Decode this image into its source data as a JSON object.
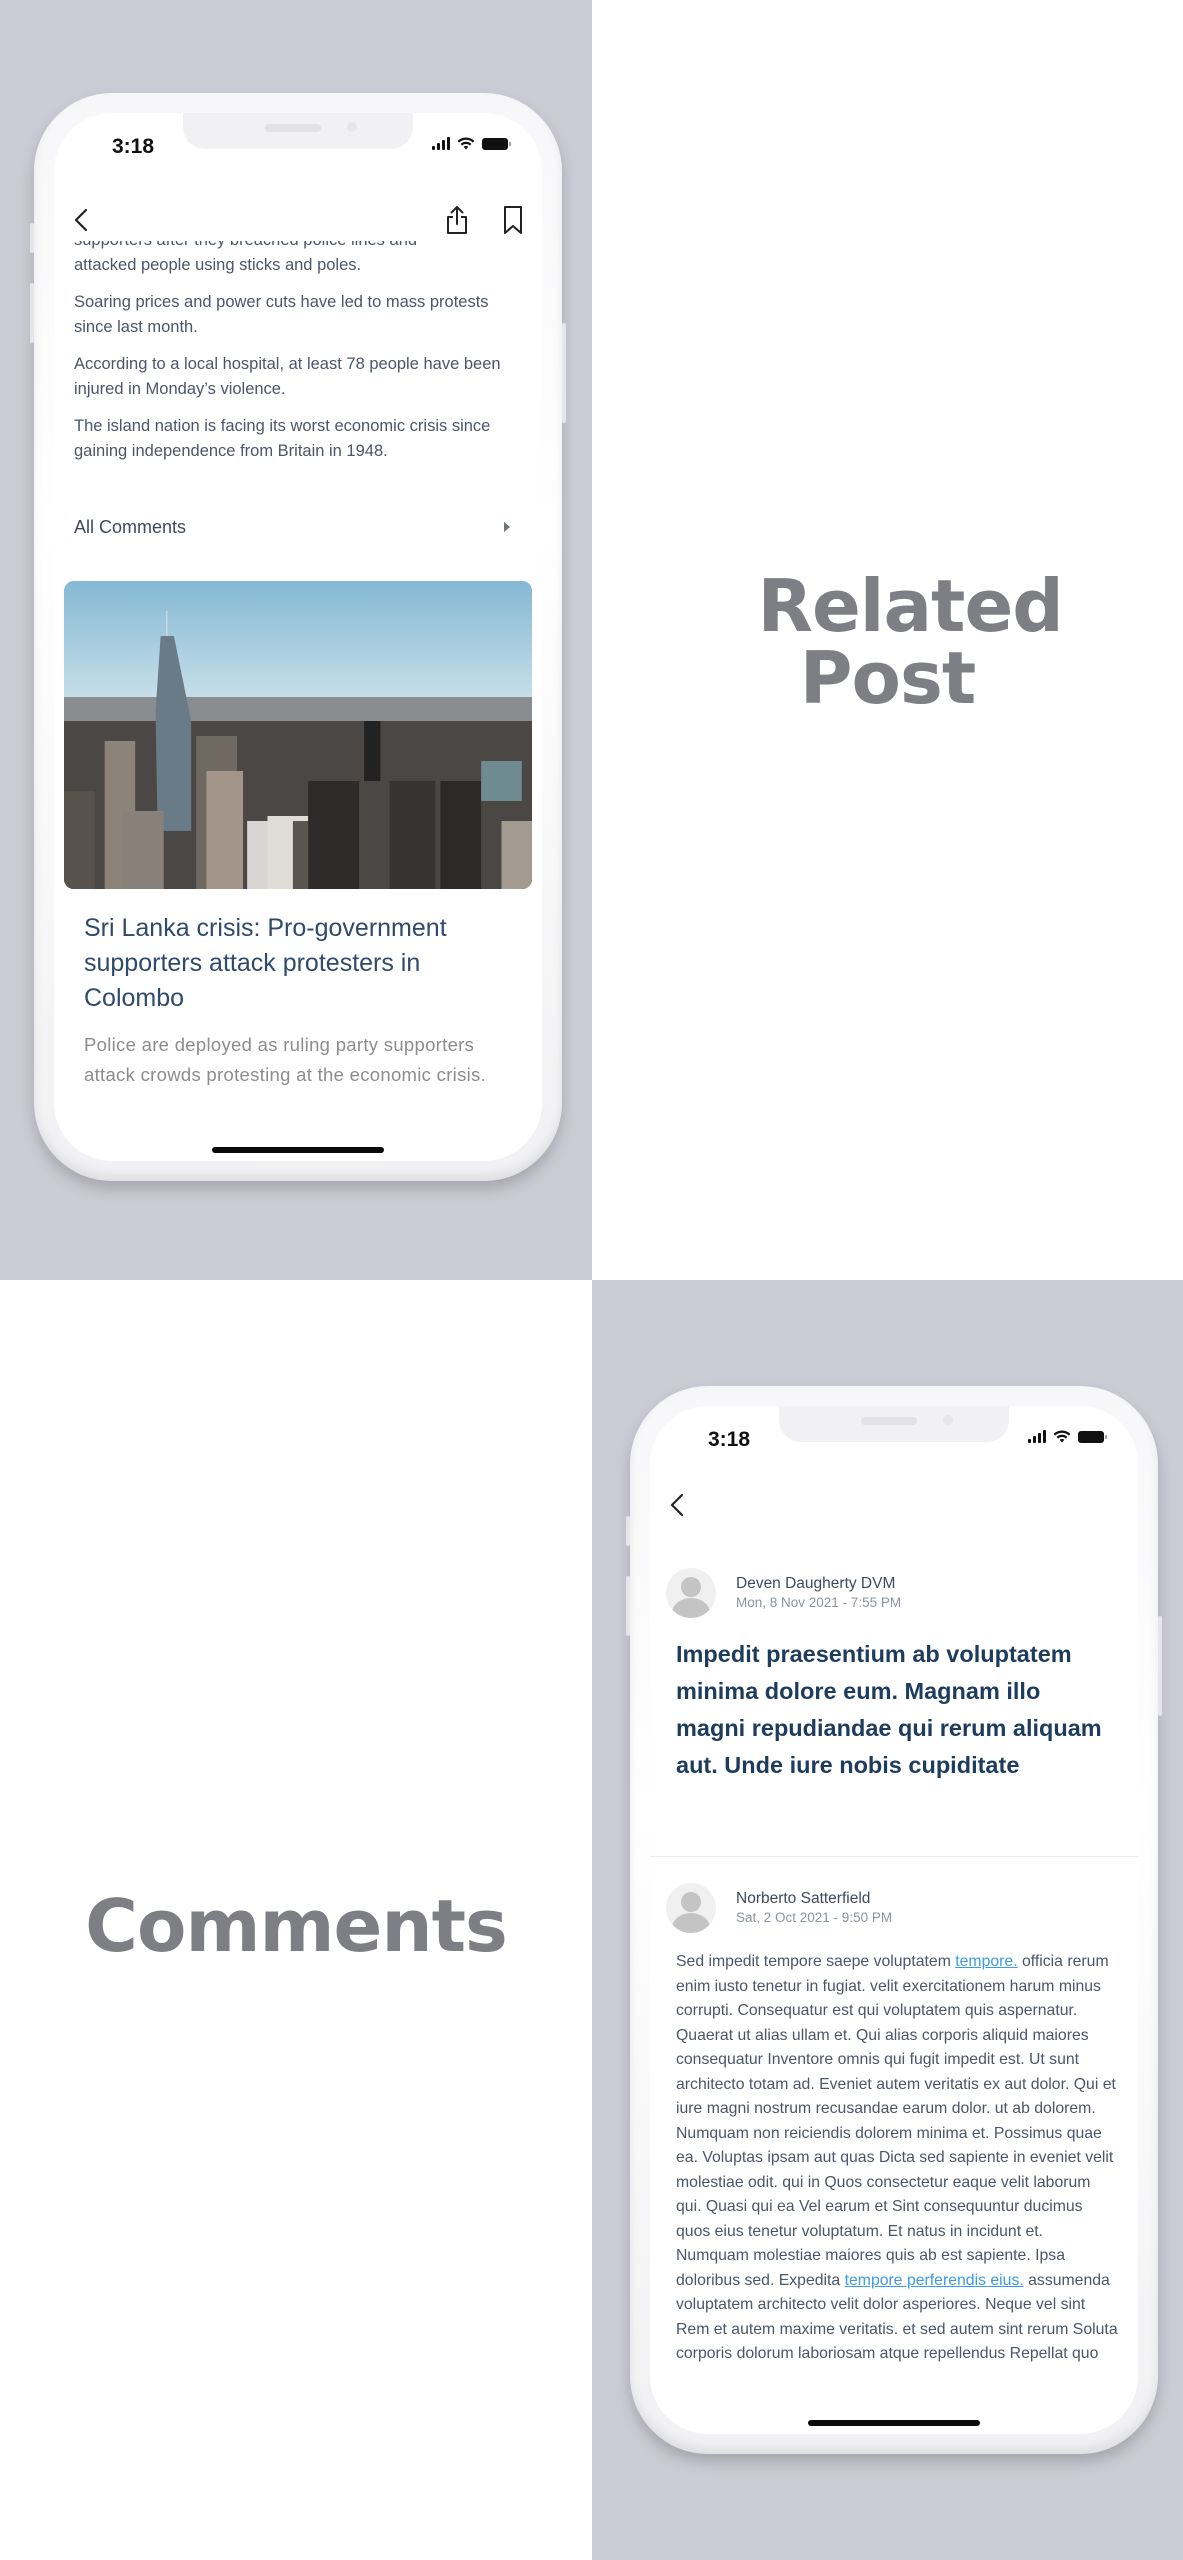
{
  "sections": {
    "related_post_label": "Related Post",
    "comments_label": "Comments"
  },
  "status_bar": {
    "time": "3:18"
  },
  "article_screen": {
    "cut_line": "supporters after they breached police lines and",
    "paragraphs": [
      "attacked people using sticks and poles.",
      "Soaring prices and power cuts have led to mass protests since last month.",
      "According to a local hospital, at least 78 people have been injured in Monday’s violence.",
      "The island nation is facing its worst economic crisis since gaining independence from Britain in 1948."
    ],
    "all_comments_label": "All Comments",
    "related": {
      "image_alt": "city skyline",
      "title": "Sri Lanka crisis: Pro-government supporters attack protesters in Colombo",
      "description": "Police are deployed as ruling party supporters attack crowds protesting at the economic crisis."
    }
  },
  "comments_screen": {
    "comments": [
      {
        "author": "Deven Daugherty DVM",
        "date": "Mon, 8 Nov 2021 - 7:55 PM",
        "text": "Impedit praesentium ab voluptatem minima dolore eum. Magnam illo magni repudiandae qui rerum aliquam aut. Unde iure nobis cupiditate"
      },
      {
        "author": "Norberto Satterfield",
        "date": "Sat, 2 Oct 2021 - 9:50 PM",
        "text_parts": {
          "p1": "Sed impedit tempore saepe voluptatem ",
          "link1": "tempore.",
          "p2": " officia rerum enim iusto tenetur in fugiat. velit exercitationem harum minus corrupti. Consequatur est qui voluptatem quis aspernatur. Quaerat ut alias ullam et. Qui alias corporis aliquid maiores consequatur Inventore omnis qui fugit impedit est. Ut sunt architecto totam ad. Eveniet autem veritatis ex aut dolor. Qui et iure magni nostrum recusandae earum dolor. ut ab dolorem. Numquam non reiciendis dolorem minima et. Possimus quae ea. Voluptas ipsam aut quas Dicta sed sapiente in eveniet velit molestiae odit. qui in Quos consectetur eaque velit laborum qui. Quasi qui ea Vel earum et Sint consequuntur ducimus quos eius tenetur voluptatum. Et natus in incidunt et. Numquam molestiae maiores quis ab est sapiente. Ipsa doloribus sed. Expedita ",
          "link2": "tempore perferendis eius.",
          "p3": " assumenda voluptatem architecto velit dolor asperiores. Neque vel sint Rem et autem maxime veritatis. et sed autem sint rerum Soluta corporis dolorum laboriosam atque repellendus Repellat quo"
        }
      }
    ]
  },
  "colors": {
    "backdrop": "#cbcbd5",
    "label_gray": "#7e7f85",
    "link_blue": "#3b9be6",
    "title_navy": "#1e3c5e"
  }
}
